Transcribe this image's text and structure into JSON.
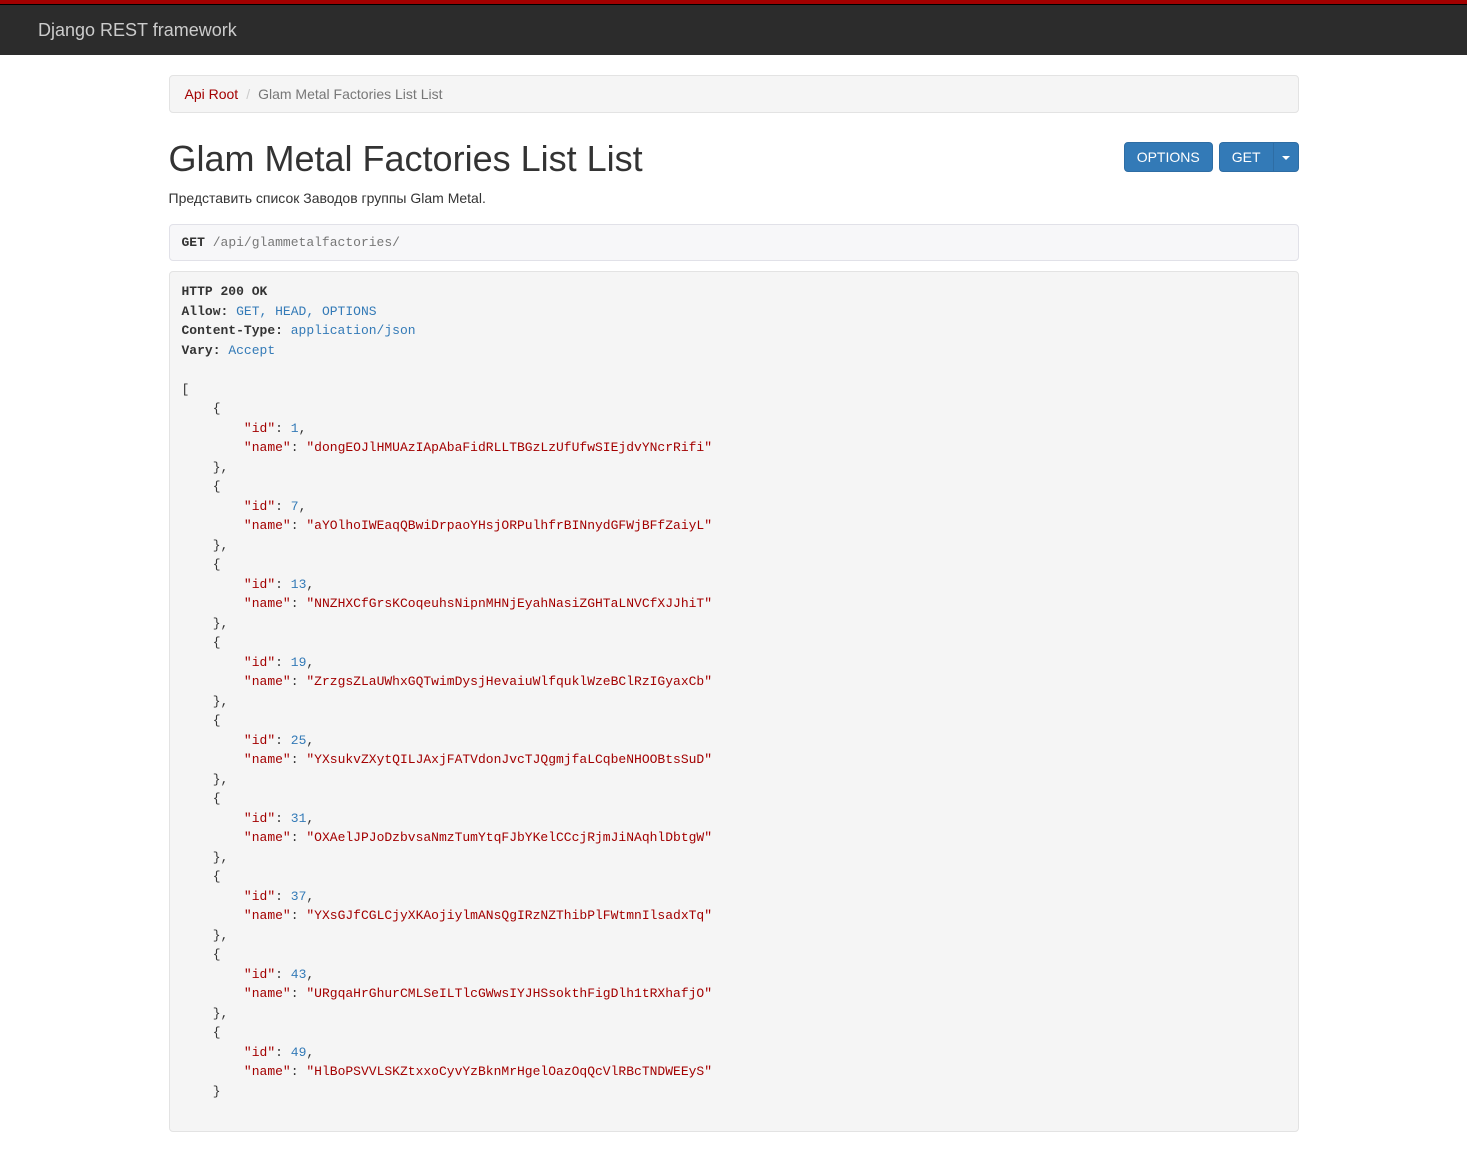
{
  "navbar": {
    "brand": "Django REST framework"
  },
  "breadcrumb": {
    "root": "Api Root",
    "current": "Glam Metal Factories List List"
  },
  "page": {
    "title": "Glam Metal Factories List List",
    "description": "Представить список Заводов группы Glam Metal."
  },
  "buttons": {
    "options": "OPTIONS",
    "get": "GET"
  },
  "request": {
    "method": "GET",
    "path": "/api/glammetalfactories/"
  },
  "response_headers": {
    "status": "HTTP 200 OK",
    "allow_label": "Allow:",
    "allow_value": "GET, HEAD, OPTIONS",
    "content_type_label": "Content-Type:",
    "content_type_value": "application/json",
    "vary_label": "Vary:",
    "vary_value": "Accept"
  },
  "response_body": [
    {
      "id": 1,
      "name": "dongEOJlHMUAzIApAbaFidRLLTBGzLzUfUfwSIEjdvYNcrRifi"
    },
    {
      "id": 7,
      "name": "aYOlhoIWEaqQBwiDrpaoYHsjORPulhfrBINnydGFWjBFfZaiyL"
    },
    {
      "id": 13,
      "name": "NNZHXCfGrsKCoqeuhsNipnMHNjEyahNasiZGHTaLNVCfXJJhiT"
    },
    {
      "id": 19,
      "name": "ZrzgsZLaUWhxGQTwimDysjHevaiuWlfquklWzeBClRzIGyaxCb"
    },
    {
      "id": 25,
      "name": "YXsukvZXytQILJAxjFATVdonJvcTJQgmjfaLCqbeNHOOBtsSuD"
    },
    {
      "id": 31,
      "name": "OXAelJPJoDzbvsaNmzTumYtqFJbYKelCCcjRjmJiNAqhlDbtgW"
    },
    {
      "id": 37,
      "name": "YXsGJfCGLCjyXKAojiylmANsQgIRzNZThibPlFWtmnIlsadxTq"
    },
    {
      "id": 43,
      "name": "URgqaHrGhurCMLSeILTlcGWwsIYJHSsokthFigDlh1tRXhafjO"
    },
    {
      "id": 49,
      "name": "HlBoPSVVLSKZtxxoCyvYzBknMrHgelOazOqQcVlRBcTNDWEEyS"
    }
  ]
}
